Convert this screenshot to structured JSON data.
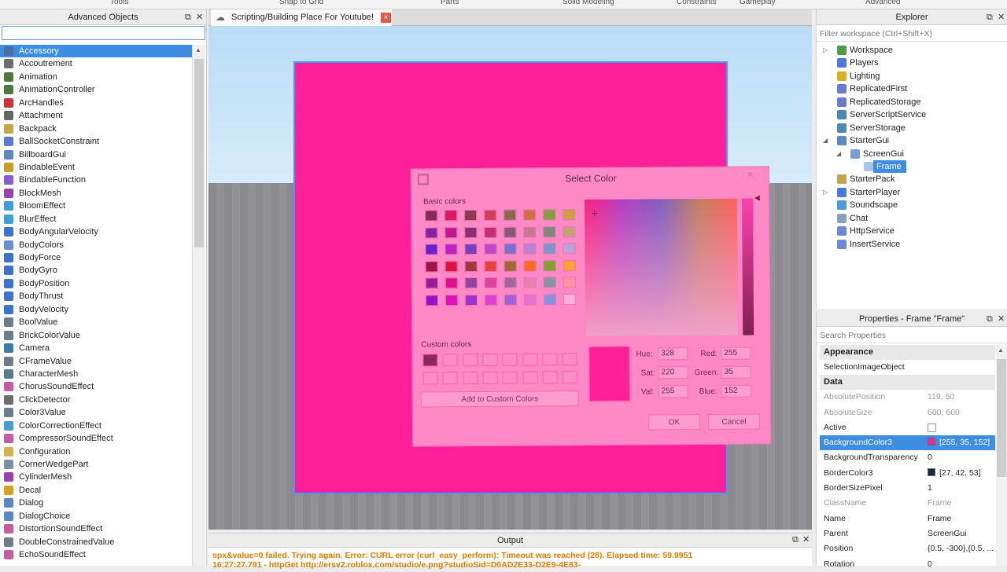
{
  "ribbon": {
    "tabs": [
      "Tools",
      "Snap to Grid",
      "Parts",
      "Solid Modeling",
      "Constraints",
      "Gameplay",
      "Advanced"
    ]
  },
  "advanced_objects": {
    "title": "Advanced Objects",
    "filter_value": "",
    "items": [
      {
        "label": "Accessory",
        "icon": "accessory-icon",
        "color": "#4a6fa5"
      },
      {
        "label": "Accoutrement",
        "icon": "hat-icon",
        "color": "#6d6d6d"
      },
      {
        "label": "Animation",
        "icon": "animation-icon",
        "color": "#4f7a3e"
      },
      {
        "label": "AnimationController",
        "icon": "animation-controller-icon",
        "color": "#4f7a3e"
      },
      {
        "label": "ArcHandles",
        "icon": "arc-handles-icon",
        "color": "#cc3333"
      },
      {
        "label": "Attachment",
        "icon": "attachment-icon",
        "color": "#666666"
      },
      {
        "label": "Backpack",
        "icon": "backpack-icon",
        "color": "#c9a34b"
      },
      {
        "label": "BallSocketConstraint",
        "icon": "constraint-icon",
        "color": "#5a7bd6"
      },
      {
        "label": "BillboardGui",
        "icon": "gui-icon",
        "color": "#5a87c6"
      },
      {
        "label": "BindableEvent",
        "icon": "lightning-icon",
        "color": "#c9a020"
      },
      {
        "label": "BindableFunction",
        "icon": "function-icon",
        "color": "#8a5ad6"
      },
      {
        "label": "BlockMesh",
        "icon": "mesh-icon",
        "color": "#9b3fb5"
      },
      {
        "label": "BloomEffect",
        "icon": "effect-icon",
        "color": "#3f9fd6"
      },
      {
        "label": "BlurEffect",
        "icon": "effect-icon",
        "color": "#3f9fd6"
      },
      {
        "label": "BodyAngularVelocity",
        "icon": "body-mover-icon",
        "color": "#3b73d1"
      },
      {
        "label": "BodyColors",
        "icon": "body-colors-icon",
        "color": "#6b8fd6"
      },
      {
        "label": "BodyForce",
        "icon": "body-mover-icon",
        "color": "#3b73d1"
      },
      {
        "label": "BodyGyro",
        "icon": "body-mover-icon",
        "color": "#3b73d1"
      },
      {
        "label": "BodyPosition",
        "icon": "body-mover-icon",
        "color": "#3b73d1"
      },
      {
        "label": "BodyThrust",
        "icon": "body-mover-icon",
        "color": "#3b73d1"
      },
      {
        "label": "BodyVelocity",
        "icon": "body-mover-icon",
        "color": "#3b73d1"
      },
      {
        "label": "BoolValue",
        "icon": "value-icon",
        "color": "#6b7d8f"
      },
      {
        "label": "BrickColorValue",
        "icon": "value-icon",
        "color": "#6b7d8f"
      },
      {
        "label": "Camera",
        "icon": "camera-icon",
        "color": "#3a7ea8"
      },
      {
        "label": "CFrameValue",
        "icon": "value-icon",
        "color": "#6b7d8f"
      },
      {
        "label": "CharacterMesh",
        "icon": "character-mesh-icon",
        "color": "#5a7a8f"
      },
      {
        "label": "ChorusSoundEffect",
        "icon": "sound-effect-icon",
        "color": "#c85a9f"
      },
      {
        "label": "ClickDetector",
        "icon": "click-icon",
        "color": "#6d6d6d"
      },
      {
        "label": "Color3Value",
        "icon": "value-icon",
        "color": "#6b7d8f"
      },
      {
        "label": "ColorCorrectionEffect",
        "icon": "effect-icon",
        "color": "#3f9fd6"
      },
      {
        "label": "CompressorSoundEffect",
        "icon": "sound-effect-icon",
        "color": "#c85a9f"
      },
      {
        "label": "Configuration",
        "icon": "folder-icon",
        "color": "#d6b04a"
      },
      {
        "label": "CornerWedgePart",
        "icon": "wedge-icon",
        "color": "#7a8fa8"
      },
      {
        "label": "CylinderMesh",
        "icon": "mesh-icon",
        "color": "#9b3fb5"
      },
      {
        "label": "Decal",
        "icon": "decal-icon",
        "color": "#d6a020"
      },
      {
        "label": "Dialog",
        "icon": "dialog-icon",
        "color": "#5a87c6"
      },
      {
        "label": "DialogChoice",
        "icon": "dialog-icon",
        "color": "#5a87c6"
      },
      {
        "label": "DistortionSoundEffect",
        "icon": "sound-effect-icon",
        "color": "#c85a9f"
      },
      {
        "label": "DoubleConstrainedValue",
        "icon": "value-icon",
        "color": "#6b7d8f"
      },
      {
        "label": "EchoSoundEffect",
        "icon": "sound-effect-icon",
        "color": "#c85a9f"
      }
    ]
  },
  "tab": {
    "title": "Scripting/Building Place For Youtube!",
    "close": "×"
  },
  "color_dialog": {
    "title": "Select Color",
    "basic_colors_label": "Basic colors",
    "custom_colors_label": "Custom colors",
    "add_custom_label": "Add to Custom Colors",
    "ok_label": "OK",
    "cancel_label": "Cancel",
    "hue_label": "Hue:",
    "hue": "328",
    "sat_label": "Sat:",
    "sat": "220",
    "val_label": "Val:",
    "val": "255",
    "red_label": "Red:",
    "red": "255",
    "green_label": "Green:",
    "green": "35",
    "blue_label": "Blue:",
    "blue": "152",
    "basic_colors": [
      "#8a2a5a",
      "#d81a60",
      "#8f3a48",
      "#d04058",
      "#8a6a4a",
      "#d07040",
      "#80a040",
      "#d0a040",
      "#8a20a8",
      "#c01890",
      "#8a3070",
      "#c03078",
      "#8a5878",
      "#c87890",
      "#80887a",
      "#c8a078",
      "#6a20d0",
      "#c020c8",
      "#7840c0",
      "#c048c8",
      "#7a70d0",
      "#c080d0",
      "#7898d0",
      "#c0a0d8",
      "#a0104a",
      "#e01040",
      "#a03a3a",
      "#e84040",
      "#a06a30",
      "#ff6a20",
      "#80a030",
      "#ffa030",
      "#9a1a9a",
      "#e01090",
      "#9a40a0",
      "#e040a0",
      "#a06aa0",
      "#e880b0",
      "#8a90a8",
      "#ff90a0",
      "#9a10c8",
      "#e010c0",
      "#a030d0",
      "#e040d0",
      "#a060d8",
      "#e870d0",
      "#8890e0",
      "#ffb0d8"
    ]
  },
  "output": {
    "title": "Output",
    "lines": [
      "spx&value=0 failed. Trying again. Error: CURL error (curl_easy_perform): Timeout was reached (28). Elapsed time: 59.9951",
      "16:27:27.791 - httpGet http://ersv2.roblox.com/studio/e.png?studioSid=D0AD2E33-D2E9-4E83-"
    ]
  },
  "explorer": {
    "title": "Explorer",
    "filter_placeholder": "Filter workspace (Ctrl+Shift+X)",
    "nodes": [
      {
        "label": "Workspace",
        "icon": "workspace-icon",
        "color": "#4aa04a",
        "depth": 0,
        "arrow": "▷"
      },
      {
        "label": "Players",
        "icon": "players-icon",
        "color": "#4a7ad6",
        "depth": 0,
        "arrow": ""
      },
      {
        "label": "Lighting",
        "icon": "lighting-icon",
        "color": "#d6b020",
        "depth": 0,
        "arrow": ""
      },
      {
        "label": "ReplicatedFirst",
        "icon": "replicated-first-icon",
        "color": "#6a7ad0",
        "depth": 0,
        "arrow": ""
      },
      {
        "label": "ReplicatedStorage",
        "icon": "replicated-storage-icon",
        "color": "#6a7ad0",
        "depth": 0,
        "arrow": ""
      },
      {
        "label": "ServerScriptService",
        "icon": "server-script-service-icon",
        "color": "#4a8ab0",
        "depth": 0,
        "arrow": ""
      },
      {
        "label": "ServerStorage",
        "icon": "server-storage-icon",
        "color": "#4a8ab0",
        "depth": 0,
        "arrow": ""
      },
      {
        "label": "StarterGui",
        "icon": "starter-gui-icon",
        "color": "#5a87c6",
        "depth": 0,
        "arrow": "◢"
      },
      {
        "label": "ScreenGui",
        "icon": "screen-gui-icon",
        "color": "#7a9ad6",
        "depth": 1,
        "arrow": "◢"
      },
      {
        "label": "Frame",
        "icon": "frame-icon",
        "color": "#a8c4ea",
        "depth": 2,
        "arrow": "",
        "selected": true
      },
      {
        "label": "StarterPack",
        "icon": "starter-pack-icon",
        "color": "#c9a34b",
        "depth": 0,
        "arrow": ""
      },
      {
        "label": "StarterPlayer",
        "icon": "starter-player-icon",
        "color": "#4a7ad6",
        "depth": 0,
        "arrow": "▷"
      },
      {
        "label": "Soundscape",
        "icon": "soundscape-icon",
        "color": "#4a9ad6",
        "depth": 0,
        "arrow": ""
      },
      {
        "label": "Chat",
        "icon": "chat-icon",
        "color": "#8aa0c0",
        "depth": 0,
        "arrow": ""
      },
      {
        "label": "HttpService",
        "icon": "http-service-icon",
        "color": "#6a8ad6",
        "depth": 0,
        "arrow": ""
      },
      {
        "label": "InsertService",
        "icon": "insert-service-icon",
        "color": "#6a8ad6",
        "depth": 0,
        "arrow": ""
      }
    ]
  },
  "properties": {
    "title": "Properties - Frame \"Frame\"",
    "filter_placeholder": "Search Properties",
    "rows": [
      {
        "kind": "cat",
        "k": "Appearance"
      },
      {
        "kind": "row",
        "k": "SelectionImageObject",
        "v": ""
      },
      {
        "kind": "cat",
        "k": "Data"
      },
      {
        "kind": "row",
        "k": "AbsolutePosition",
        "v": "119, 50",
        "ro": true
      },
      {
        "kind": "row",
        "k": "AbsoluteSize",
        "v": "600, 600",
        "ro": true
      },
      {
        "kind": "row",
        "k": "Active",
        "v": "",
        "check": true
      },
      {
        "kind": "row",
        "k": "BackgroundColor3",
        "v": "[255, 35, 152]",
        "swatch": "#ff2398",
        "sel": true
      },
      {
        "kind": "row",
        "k": "BackgroundTransparency",
        "v": "0"
      },
      {
        "kind": "row",
        "k": "BorderColor3",
        "v": "[27, 42, 53]",
        "swatch": "#1b2a35"
      },
      {
        "kind": "row",
        "k": "BorderSizePixel",
        "v": "1"
      },
      {
        "kind": "row",
        "k": "ClassName",
        "v": "Frame",
        "ro": true
      },
      {
        "kind": "row",
        "k": "Name",
        "v": "Frame"
      },
      {
        "kind": "row",
        "k": "Parent",
        "v": "ScreenGui"
      },
      {
        "kind": "row",
        "k": "Position",
        "v": "{0.5, -300},{0.5, ..."
      },
      {
        "kind": "row",
        "k": "Rotation",
        "v": "0"
      }
    ]
  }
}
